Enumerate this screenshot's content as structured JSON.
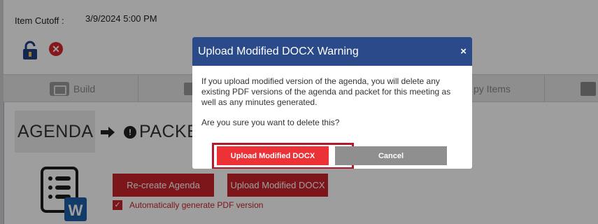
{
  "page": {
    "item_cutoff_label": "Item Cutoff :",
    "item_cutoff_value": "3/9/2024 5:00 PM",
    "toolbar": {
      "build_label": "Build",
      "copy_items_label": "py Items"
    },
    "agenda_tab_label": "AGENDA",
    "packet_tab_label": "PACKE",
    "recreate_button_label": "Re-create Agenda",
    "upload_button_label": "Upload Modified DOCX",
    "auto_pdf_label": "Automatically generate PDF version",
    "auto_pdf_checked": true
  },
  "modal": {
    "title": "Upload Modified DOCX Warning",
    "close_glyph": "×",
    "message": "If you upload modified version of the agenda, you will delete any existing PDF versions of the agenda and packet for this meeting as well as any minutes generated.",
    "question": "Are you sure you want to delete this?",
    "confirm_label": "Upload Modified DOCX",
    "cancel_label": "Cancel"
  },
  "colors": {
    "modal_header": "#2a4a8a",
    "primary_red": "#ed3237",
    "dark_red": "#c9252b",
    "cancel_gray": "#8f8f8f"
  },
  "icons": [
    "lock-icon",
    "delete-icon",
    "build-icon",
    "edit-icon",
    "arrow-right-icon",
    "lock-circle-icon",
    "word-document-icon",
    "checkbox-icon",
    "close-icon"
  ]
}
